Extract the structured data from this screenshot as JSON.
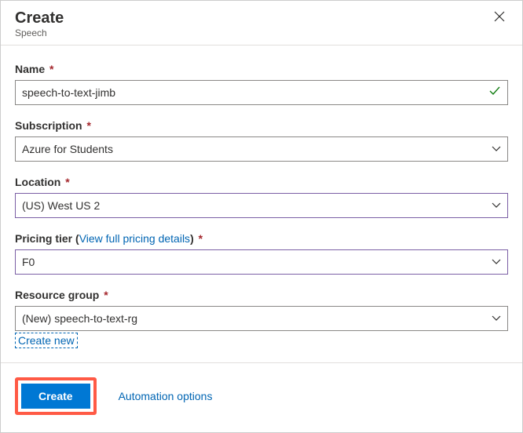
{
  "header": {
    "title": "Create",
    "subtitle": "Speech"
  },
  "fields": {
    "name": {
      "label": "Name",
      "value": "speech-to-text-jimb"
    },
    "subscription": {
      "label": "Subscription",
      "value": "Azure for Students"
    },
    "location": {
      "label": "Location",
      "value": "(US) West US 2"
    },
    "pricing": {
      "label_prefix": "Pricing tier (",
      "link_text": "View full pricing details",
      "label_suffix": ")",
      "value": "F0"
    },
    "resource_group": {
      "label": "Resource group",
      "value": "(New) speech-to-text-rg",
      "create_new": "Create new"
    }
  },
  "footer": {
    "create_label": "Create",
    "automation_label": "Automation options"
  }
}
